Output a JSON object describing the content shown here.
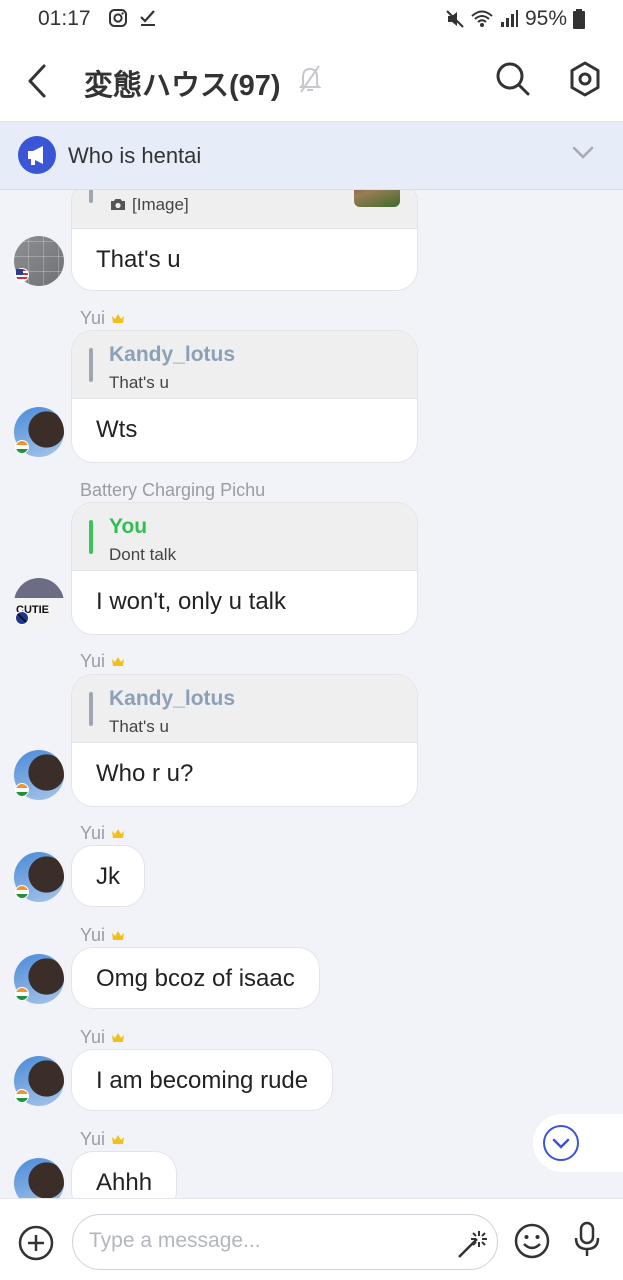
{
  "status_bar": {
    "time": "01:17",
    "battery": "95%"
  },
  "header": {
    "title": "変態ハウス(97)"
  },
  "announcement": {
    "text": "Who is hentai"
  },
  "messages": [
    {
      "sender": "",
      "reply_name": "",
      "reply_text": "[Image]",
      "text": "That's u"
    },
    {
      "sender": "Yui",
      "reply_name": "Kandy_lotus",
      "reply_text": "That's u",
      "text": "Wts"
    },
    {
      "sender": "Battery Charging Pichu",
      "reply_name": "You",
      "reply_text": "Dont talk",
      "text": "I won't, only u talk"
    },
    {
      "sender": "Yui",
      "reply_name": "Kandy_lotus",
      "reply_text": "That's u",
      "text": "Who r u?"
    },
    {
      "sender": "Yui",
      "text": "Jk"
    },
    {
      "sender": "Yui",
      "text": "Omg bcoz of isaac"
    },
    {
      "sender": "Yui",
      "text": "I am becoming rude"
    },
    {
      "sender": "Yui",
      "text": "Ahhh"
    }
  ],
  "input": {
    "placeholder": "Type a message..."
  },
  "colors": {
    "accent": "#3a55d6",
    "reply_green": "#33be55",
    "reply_name_gray": "#8ca0b8",
    "background": "#f2f3f8"
  },
  "icons": {
    "back": "chevron-left-icon",
    "mute": "bell-off-icon",
    "search": "search-icon",
    "settings": "gear-icon",
    "announcement": "megaphone-icon",
    "expand": "chevron-down-icon",
    "add": "plus-circle-icon",
    "magic": "magic-wand-icon",
    "emoji": "smiley-icon",
    "mic": "microphone-icon",
    "scroll_down": "chevron-down-circle-icon"
  }
}
